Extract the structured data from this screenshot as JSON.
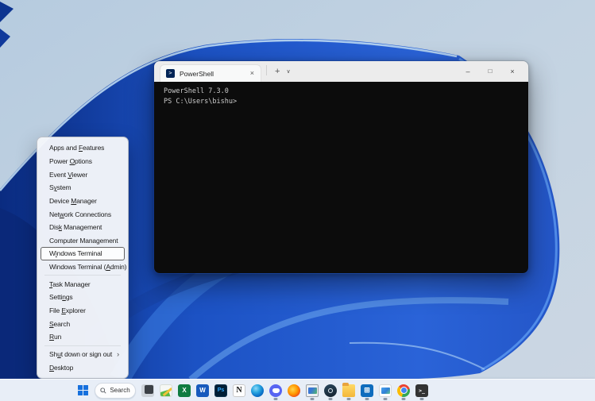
{
  "context_menu": {
    "submenu_arrow": "›",
    "items": [
      {
        "label": "Apps and Features",
        "accel": 9
      },
      {
        "label": "Power Options",
        "accel": 6
      },
      {
        "label": "Event Viewer",
        "accel": 6
      },
      {
        "label": "System",
        "accel": 1
      },
      {
        "label": "Device Manager",
        "accel": 7
      },
      {
        "label": "Network Connections",
        "accel": 3
      },
      {
        "label": "Disk Management",
        "accel": 3
      },
      {
        "label": "Computer Management",
        "accel": 13
      },
      {
        "label": "Windows Terminal",
        "accel": 1,
        "highlighted": true
      },
      {
        "label": "Windows Terminal (Admin)",
        "accel": 18,
        "separator_after": true
      },
      {
        "label": "Task Manager",
        "accel": 0
      },
      {
        "label": "Settings",
        "accel": 5
      },
      {
        "label": "File Explorer",
        "accel": 5
      },
      {
        "label": "Search",
        "accel": 0
      },
      {
        "label": "Run",
        "accel": 0,
        "separator_after": true
      },
      {
        "label": "Shut down or sign out",
        "accel": 2,
        "submenu": true
      },
      {
        "label": "Desktop",
        "accel": 0
      }
    ]
  },
  "terminal_window": {
    "tab_title": "PowerShell",
    "tab_close_glyph": "×",
    "new_tab_glyph": "+",
    "tab_dropdown_glyph": "∨",
    "tab_icon_glyph": ">",
    "controls": {
      "minimize": "–",
      "maximize": "□",
      "close": "×"
    },
    "lines": [
      "PowerShell 7.3.0",
      "PS C:\\Users\\bishu>"
    ]
  },
  "taskbar": {
    "search": {
      "label": "Search"
    },
    "icons": [
      {
        "name": "app-window",
        "running": false,
        "glyph": ""
      },
      {
        "name": "greenshot",
        "running": false,
        "glyph": ""
      },
      {
        "name": "excel",
        "running": false,
        "glyph": "X"
      },
      {
        "name": "word",
        "running": false,
        "glyph": "W"
      },
      {
        "name": "photoshop",
        "running": false,
        "glyph": "Ps"
      },
      {
        "name": "notion",
        "running": false,
        "glyph": "N"
      },
      {
        "name": "edge",
        "running": false,
        "glyph": ""
      },
      {
        "name": "discord",
        "running": true,
        "glyph": ""
      },
      {
        "name": "firefox",
        "running": false,
        "glyph": ""
      },
      {
        "name": "media-player",
        "running": true,
        "glyph": ""
      },
      {
        "name": "steam",
        "running": true,
        "glyph": ""
      },
      {
        "name": "file-explorer",
        "running": true,
        "glyph": ""
      },
      {
        "name": "microsoft-store",
        "running": true,
        "glyph": "⊞"
      },
      {
        "name": "photos",
        "running": true,
        "glyph": ""
      },
      {
        "name": "chrome",
        "running": true,
        "glyph": ""
      },
      {
        "name": "terminal",
        "running": true,
        "glyph": ">_"
      }
    ]
  },
  "colors": {
    "taskbar_bg": "#e8eef7",
    "menu_bg": "#f4f6fa",
    "titlebar_bg": "#ececec",
    "terminal_bg": "#0c0c0c",
    "terminal_text": "#cccccc",
    "bloom_dark": "#0a2b80",
    "bloom_mid": "#1c52c4",
    "bloom_bright": "#2f6fe2",
    "desktop_light": "#c3d3e2"
  }
}
